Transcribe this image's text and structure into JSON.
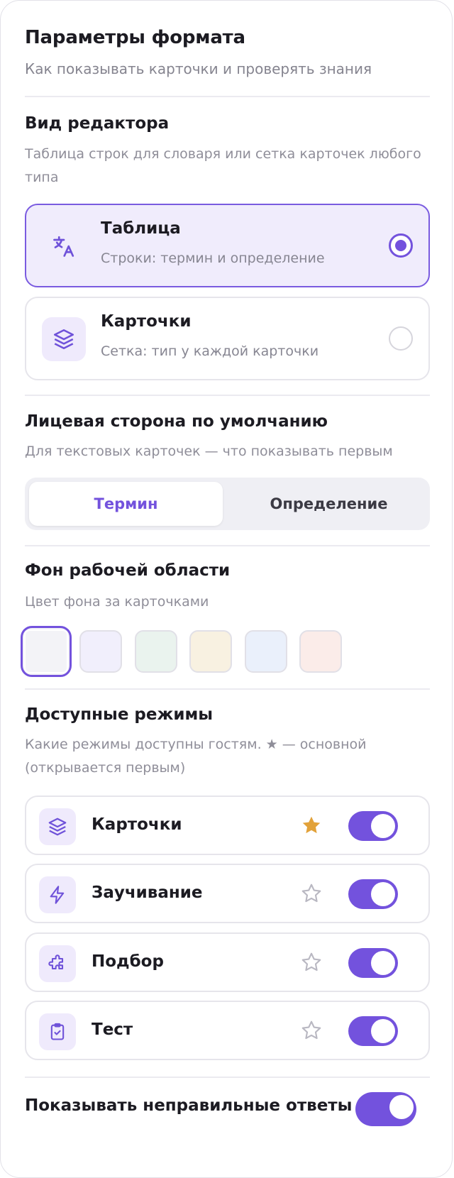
{
  "header": {
    "title": "Параметры формата",
    "subtitle": "Как показывать карточки и проверять знания"
  },
  "editor_view": {
    "title": "Вид редактора",
    "description": "Таблица строк для словаря или сетка карточек любого типа",
    "options": [
      {
        "title": "Таблица",
        "subtitle": "Строки: термин и определение",
        "icon": "translate-icon",
        "selected": true
      },
      {
        "title": "Карточки",
        "subtitle": "Сетка: тип у каждой карточки",
        "icon": "layers-icon",
        "selected": false
      }
    ]
  },
  "front_side": {
    "title": "Лицевая сторона по умолчанию",
    "description": "Для текстовых карточек — что показывать первым",
    "options": [
      "Термин",
      "Определение"
    ],
    "selected": "Термин"
  },
  "background": {
    "title": "Фон рабочей области",
    "description": "Цвет фона за карточками",
    "swatches": [
      "#f3f3f7",
      "#f1effc",
      "#eaf3ee",
      "#f8f1e1",
      "#eaf0fb",
      "#fbece9"
    ],
    "selected_index": 0
  },
  "modes": {
    "title": "Доступные режимы",
    "description": "Какие режимы доступны гостям. ★ — основной (открывается первым)",
    "items": [
      {
        "label": "Карточки",
        "icon": "layers-icon",
        "primary": true,
        "enabled": true
      },
      {
        "label": "Заучивание",
        "icon": "lightning-icon",
        "primary": false,
        "enabled": true
      },
      {
        "label": "Подбор",
        "icon": "puzzle-icon",
        "primary": false,
        "enabled": true
      },
      {
        "label": "Тест",
        "icon": "clipboard-check-icon",
        "primary": false,
        "enabled": true
      }
    ]
  },
  "show_wrong": {
    "label": "Показывать неправильные ответы",
    "enabled": true
  },
  "colors": {
    "accent": "#7352dd",
    "star_active": "#e2a23a",
    "star_inactive": "#b9b8c2"
  }
}
